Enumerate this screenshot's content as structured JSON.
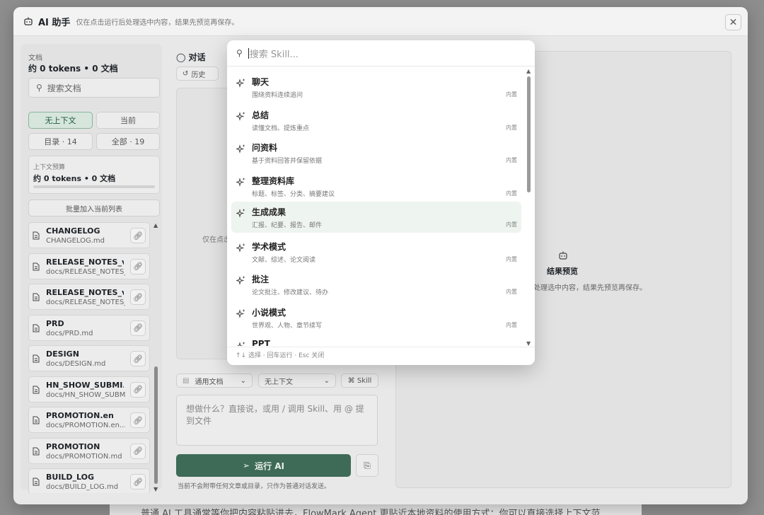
{
  "background_text": "普通 AI 工具通常等你把内容粘贴进去，FlowMark Agent 更贴近本地资料的使用方式：你可以直接选择上下文范",
  "header": {
    "title": "AI 助手",
    "subtitle": "仅在点击运行后处理选中内容，结果先预览再保存。",
    "close_label": "✕"
  },
  "left": {
    "doc_label": "文档",
    "doc_count": "约 0 tokens • 0 文档",
    "search_placeholder": "搜索文档",
    "seg_no_context": "无上下文",
    "seg_current": "当前",
    "seg_toc": "目录 · 14",
    "seg_all": "全部 · 19",
    "budget_label": "上下文预算",
    "budget_value": "约 0 tokens • 0 文档",
    "batch_label": "批量加入当前列表",
    "docs": [
      {
        "name": "CHANGELOG",
        "path": "CHANGELOG.md"
      },
      {
        "name": "RELEASE_NOTES_v...",
        "path": "docs/RELEASE_NOTES_..."
      },
      {
        "name": "RELEASE_NOTES_v...",
        "path": "docs/RELEASE_NOTES_..."
      },
      {
        "name": "PRD",
        "path": "docs/PRD.md"
      },
      {
        "name": "DESIGN",
        "path": "docs/DESIGN.md"
      },
      {
        "name": "HN_SHOW_SUBMI...",
        "path": "docs/HN_SHOW_SUBM..."
      },
      {
        "name": "PROMOTION.en",
        "path": "docs/PROMOTION.en...."
      },
      {
        "name": "PROMOTION",
        "path": "docs/PROMOTION.md"
      },
      {
        "name": "BUILD_LOG",
        "path": "docs/BUILD_LOG.md"
      }
    ]
  },
  "center": {
    "conv_title": "对话",
    "history_label": "历史",
    "conv_hint": "仅在点击",
    "mode_select": "通用文档",
    "context_select": "无上下文",
    "skill_btn": "⌘ Skill",
    "input_placeholder": "想做什么？直接说，或用 / 调用 Skill、用 @ 提到文件",
    "run_label": "运行 AI",
    "note": "当前不会附带任何文章或目录，只作为普通对话发送。"
  },
  "right": {
    "preview_title": "结果预览",
    "preview_sub": "处理选中内容，结果先预览再保存。"
  },
  "popup": {
    "search_placeholder": "搜索 Skill...",
    "skills": [
      {
        "name": "聊天",
        "desc": "围绕资料连续追问",
        "tag": "内置"
      },
      {
        "name": "总结",
        "desc": "读懂文档、提炼重点",
        "tag": "内置"
      },
      {
        "name": "问资料",
        "desc": "基于资料回答并保留依据",
        "tag": "内置"
      },
      {
        "name": "整理资料库",
        "desc": "标题、标签、分类、摘要建议",
        "tag": "内置"
      },
      {
        "name": "生成成果",
        "desc": "汇报、纪要、报告、邮件",
        "tag": "内置"
      },
      {
        "name": "学术模式",
        "desc": "文献、综述、论文阅读",
        "tag": "内置"
      },
      {
        "name": "批注",
        "desc": "论文批注、修改建议、待办",
        "tag": "内置"
      },
      {
        "name": "小说模式",
        "desc": "世界观、人物、章节续写",
        "tag": "内置"
      },
      {
        "name": "PPT",
        "desc": "",
        "tag": ""
      }
    ],
    "selected_index": 4,
    "footer": "↑↓ 选择 · 回车运行 · Esc 关闭"
  },
  "colors": {
    "accent": "#3d6b57",
    "selected_bg": "#eef4ef",
    "active_seg": "#d6e6dd"
  }
}
